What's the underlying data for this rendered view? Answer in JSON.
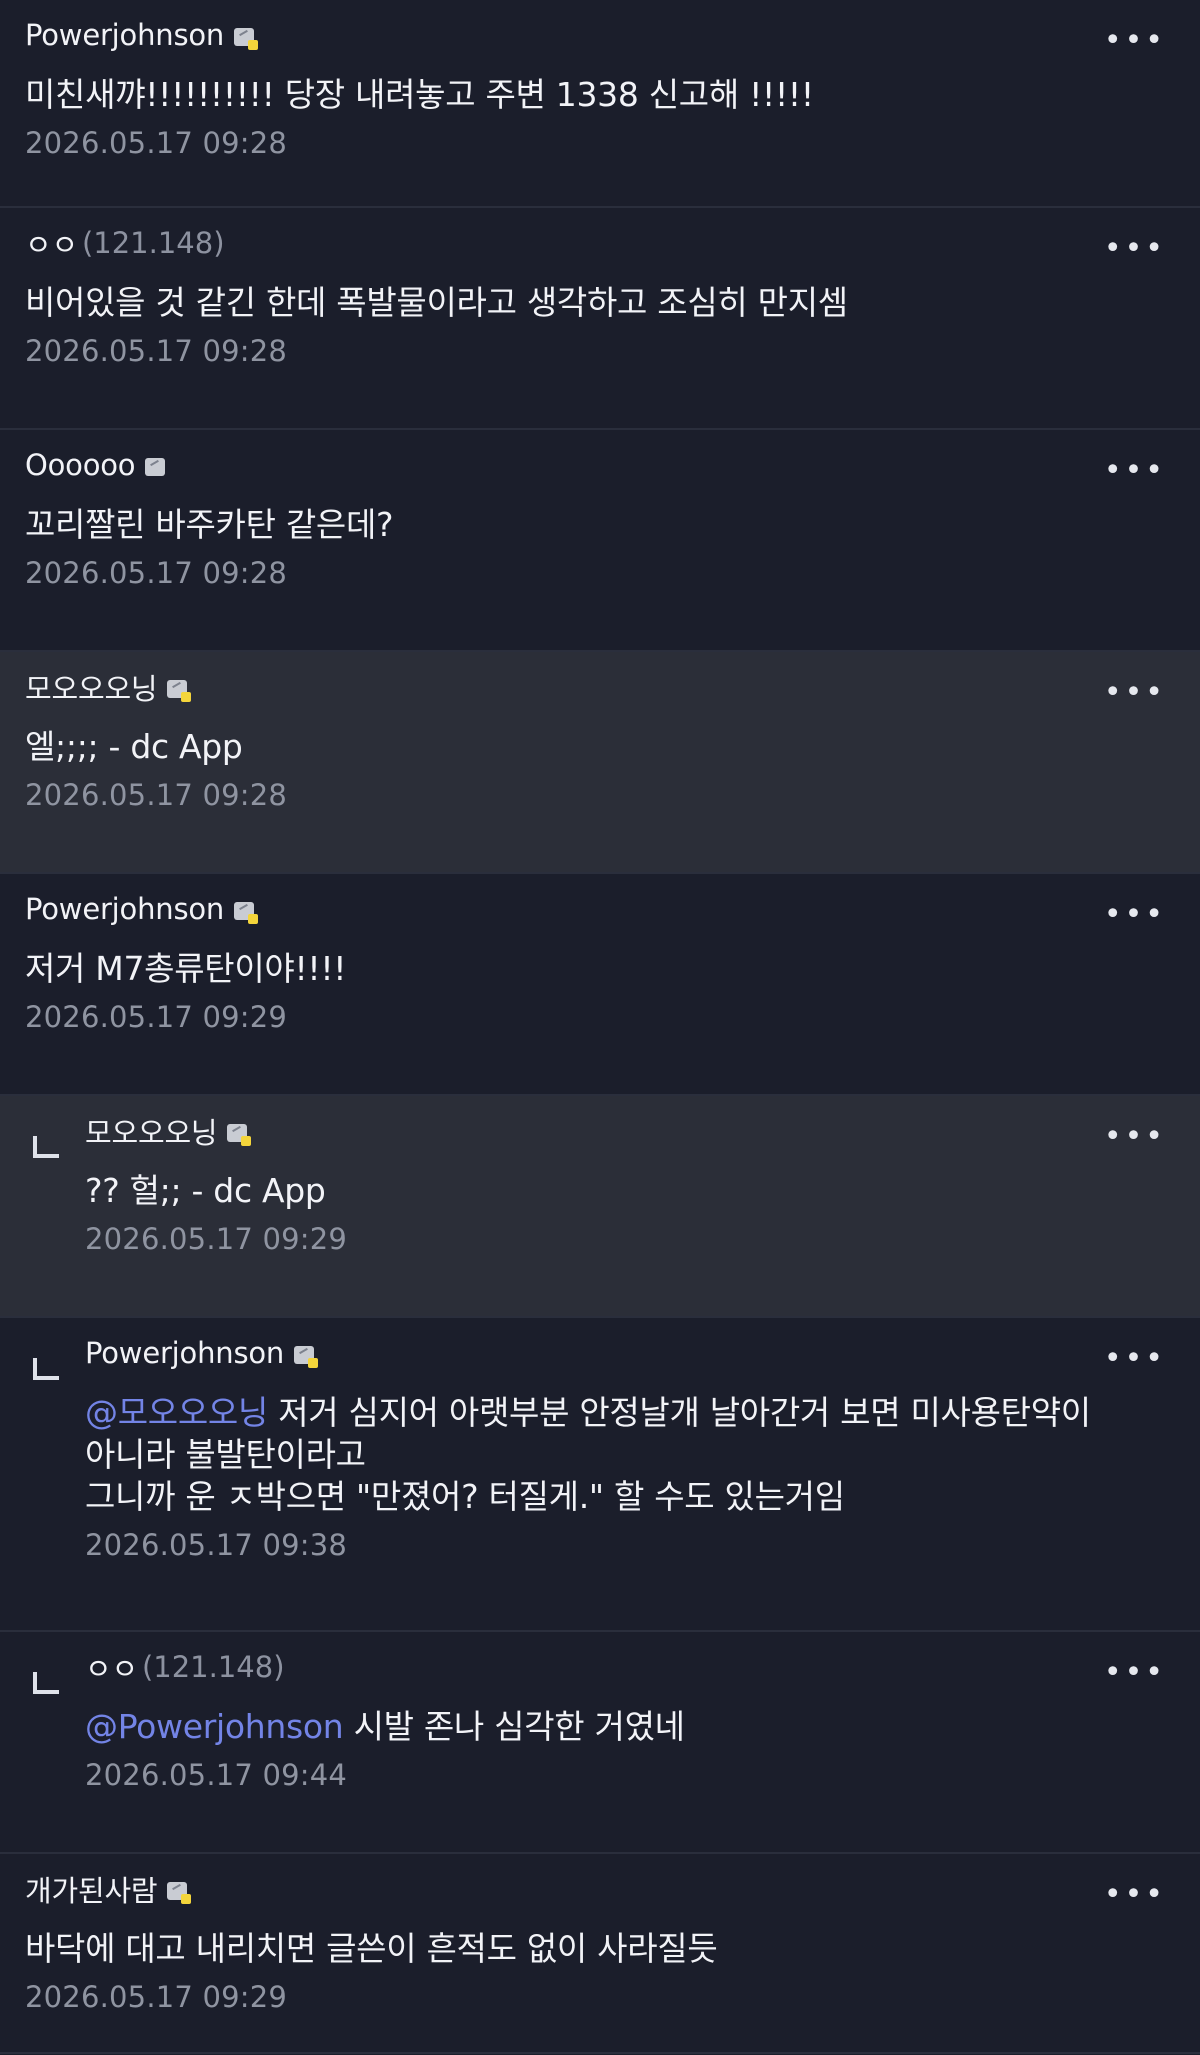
{
  "comments": [
    {
      "nickname": "Powerjohnson",
      "ip": "",
      "badge": "gallog-icon-gold",
      "text": "미친새꺄!!!!!!!!!! 당장 내려놓고 주변 1338 신고해 !!!!!",
      "mention": "",
      "timestamp": "2026.05.17 09:28",
      "reply": false,
      "highlighted": false
    },
    {
      "nickname": "ㅇㅇ",
      "ip": "(121.148)",
      "badge": "",
      "text": "비어있을 것 같긴 한데 폭발물이라고 생각하고 조심히 만지셈",
      "mention": "",
      "timestamp": "2026.05.17 09:28",
      "reply": false,
      "highlighted": false
    },
    {
      "nickname": "Oooooo",
      "ip": "",
      "badge": "gallog-icon",
      "text": "꼬리짤린 바주카탄 같은데?",
      "mention": "",
      "timestamp": "2026.05.17 09:28",
      "reply": false,
      "highlighted": false
    },
    {
      "nickname": "모오오오닝",
      "ip": "",
      "badge": "gallog-icon-gold",
      "text": "엘;;;; - dc App",
      "mention": "",
      "timestamp": "2026.05.17 09:28",
      "reply": false,
      "highlighted": true
    },
    {
      "nickname": "Powerjohnson",
      "ip": "",
      "badge": "gallog-icon-gold",
      "text": "저거 M7총류탄이야!!!!",
      "mention": "",
      "timestamp": "2026.05.17 09:29",
      "reply": false,
      "highlighted": false
    },
    {
      "nickname": "모오오오닝",
      "ip": "",
      "badge": "gallog-icon-gold",
      "text": "?? 헐;; - dc App",
      "mention": "",
      "timestamp": "2026.05.17 09:29",
      "reply": true,
      "highlighted": true
    },
    {
      "nickname": "Powerjohnson",
      "ip": "",
      "badge": "gallog-icon-gold",
      "text": " 저거 심지어 아랫부분 안정날개 날아간거 보면 미사용탄약이 아니라 불발탄이라고\n그니까 운 ㅈ박으면 \"만졌어? 터질게.\" 할 수도 있는거임",
      "mention": "@모오오오닝",
      "timestamp": "2026.05.17 09:38",
      "reply": true,
      "highlighted": false
    },
    {
      "nickname": "ㅇㅇ",
      "ip": "(121.148)",
      "badge": "",
      "text": " 시발 존나 심각한 거였네",
      "mention": "@Powerjohnson",
      "timestamp": "2026.05.17 09:44",
      "reply": true,
      "highlighted": false
    },
    {
      "nickname": "개가된사람",
      "ip": "",
      "badge": "gallog-icon-gold",
      "text": "바닥에 대고 내리치면 글쓴이 흔적도 없이 사라질듯",
      "mention": "",
      "timestamp": "2026.05.17 09:29",
      "reply": false,
      "highlighted": false
    }
  ],
  "more_icon": "more-dots-icon",
  "more_label": "•••",
  "colors": {
    "background": "#1b1e2b",
    "highlight_background": "#2b2e38",
    "mention": "#7384e6",
    "badge_accent": "#f4d53b"
  }
}
